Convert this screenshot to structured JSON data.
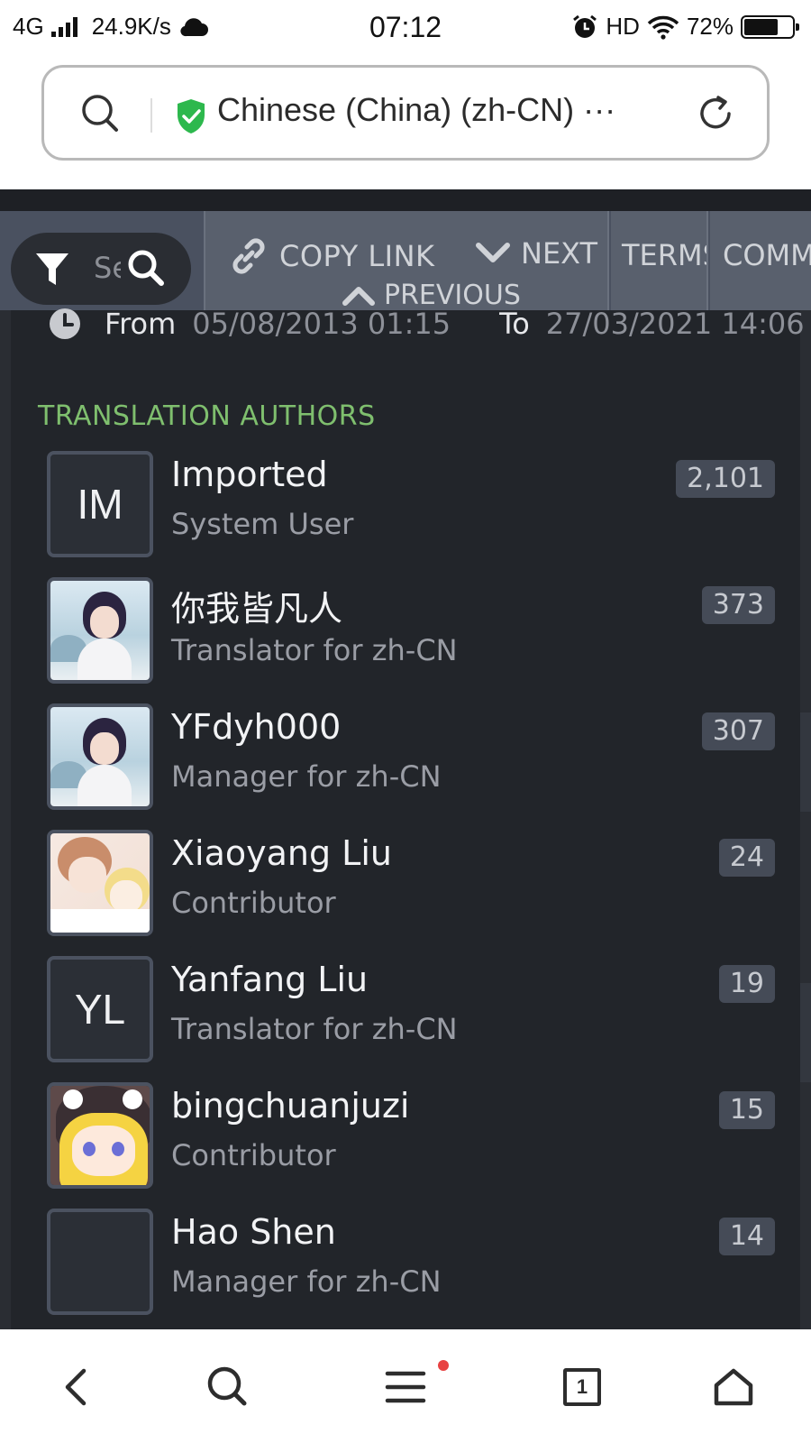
{
  "status_bar": {
    "network": "4G",
    "speed": "24.9K/s",
    "time": "07:12",
    "hd": "HD",
    "battery": "72%",
    "battery_level": 0.72,
    "icons": [
      "signal-icon",
      "cloud-icon",
      "alarm-icon",
      "wifi-icon",
      "battery-icon"
    ]
  },
  "address_bar": {
    "text": "Chinese (China) (zh-CN) ···",
    "secure_icon": "shield-check-icon",
    "colors": {
      "shield": "#2db84d"
    }
  },
  "toolbar": {
    "search_placeholder": "Search",
    "copy_link": "COPY LINK",
    "next": "NEXT",
    "previous": "PREVIOUS",
    "terms": "TERMS",
    "comments": "COMM"
  },
  "date_range": {
    "from_label": "From",
    "from_value": "05/08/2013 01:15",
    "to_label": "To",
    "to_value": "27/03/2021 14:06"
  },
  "section_title": "TRANSLATION AUTHORS",
  "authors": [
    {
      "name": "Imported",
      "role": "System User",
      "count": "2,101",
      "initials": "IM"
    },
    {
      "name": "你我皆凡人",
      "role": "Translator for zh-CN",
      "count": "373",
      "avatar": "girl-photo"
    },
    {
      "name": "YFdyh000",
      "role": "Manager for zh-CN",
      "count": "307",
      "avatar": "girl-photo"
    },
    {
      "name": "Xiaoyang Liu",
      "role": "Contributor",
      "count": "24",
      "avatar": "anime-boys"
    },
    {
      "name": "Yanfang Liu",
      "role": "Translator for zh-CN",
      "count": "19",
      "initials": "YL"
    },
    {
      "name": "bingchuanjuzi",
      "role": "Contributor",
      "count": "15",
      "avatar": "anime-girl"
    },
    {
      "name": "Hao Shen",
      "role": "Manager for zh-CN",
      "count": "14",
      "initials": ""
    }
  ],
  "bottom_nav": {
    "tabs_count": "1",
    "icons": [
      "back-icon",
      "search-icon",
      "menu-icon",
      "tabs-icon",
      "home-icon"
    ],
    "colors": {
      "notification_dot": "#e84242"
    }
  },
  "colors": {
    "page_bg": "#2a2d33",
    "panel_bg": "#22252a",
    "toolbar_bg": "#59606d",
    "section_title": "#7fbf6e"
  }
}
